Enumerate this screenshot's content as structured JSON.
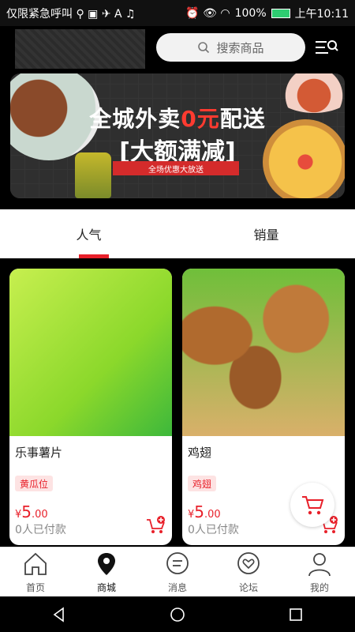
{
  "status_bar": {
    "left_text": "仅限紧急呼叫 ⚲ ▣ ✈ A ♫",
    "battery": "100%",
    "time": "上午10:11"
  },
  "header": {
    "search_placeholder": "搜索商品"
  },
  "banner": {
    "title_part1": "全城外卖",
    "title_red": "0元",
    "title_part2": "配送",
    "subtitle": "[大额满减]",
    "strip": "全场优惠大放送"
  },
  "tabs": [
    {
      "label": "人气",
      "active": true
    },
    {
      "label": "销量",
      "active": false
    }
  ],
  "products": [
    {
      "name": "乐事薯片",
      "tag": "黄瓜位",
      "currency": "¥",
      "price_int": "5",
      "price_dec": ".00",
      "sold": "0人已付款"
    },
    {
      "name": "鸡翅",
      "tag": "鸡翅",
      "currency": "¥",
      "price_int": "5",
      "price_dec": ".00",
      "sold": "0人已付款"
    }
  ],
  "bottom_nav": [
    {
      "label": "首页",
      "icon": "home-icon",
      "active": false
    },
    {
      "label": "商城",
      "icon": "location-pin-icon",
      "active": true
    },
    {
      "label": "消息",
      "icon": "message-icon",
      "active": false
    },
    {
      "label": "论坛",
      "icon": "heart-chat-icon",
      "active": false
    },
    {
      "label": "我的",
      "icon": "user-icon",
      "active": false
    }
  ],
  "colors": {
    "accent": "#e8202a"
  }
}
